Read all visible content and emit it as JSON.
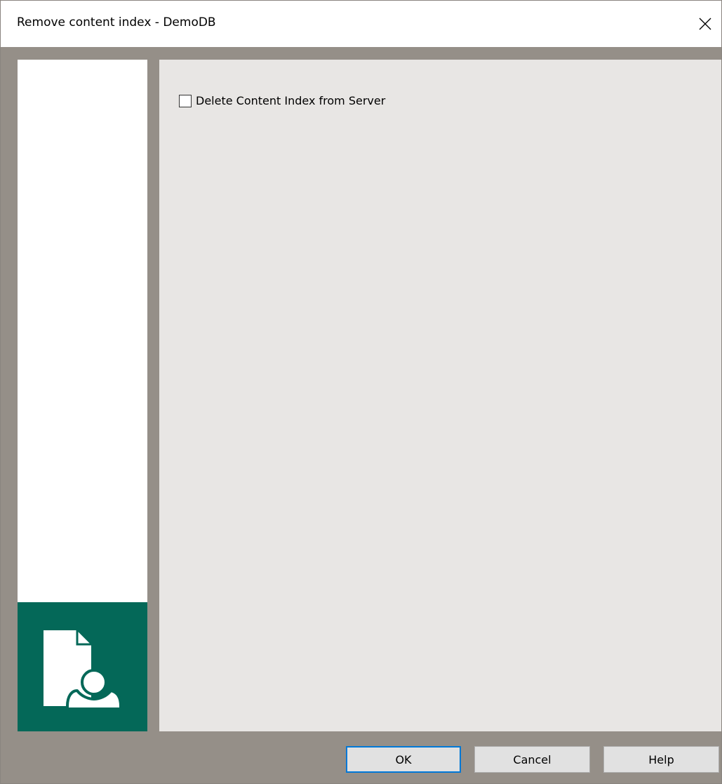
{
  "window": {
    "title": "Remove content index - DemoDB"
  },
  "options": {
    "delete_from_server": {
      "label": "Delete Content Index from Server",
      "checked": false
    }
  },
  "buttons": {
    "ok": "OK",
    "cancel": "Cancel",
    "help": "Help"
  },
  "colors": {
    "banner": "#046858",
    "frame": "#958f88",
    "content_background": "#e8e6e4",
    "default_button_border": "#0078d7"
  },
  "icons": {
    "close": "close-icon",
    "banner": "document-person-icon"
  }
}
